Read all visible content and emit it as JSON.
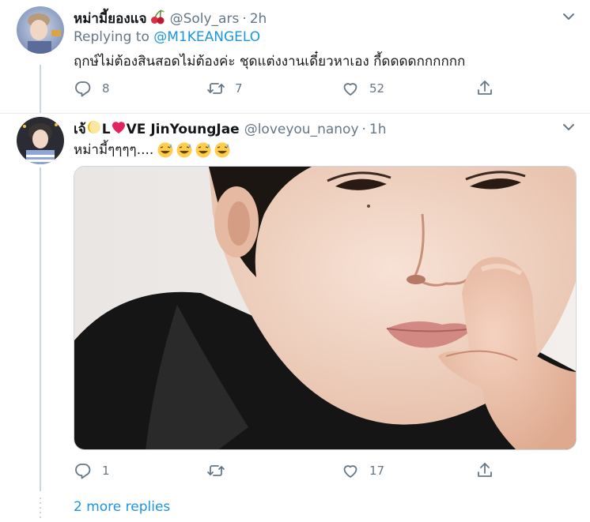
{
  "tweet1": {
    "display_name": "หม่ามี้ยองแจ",
    "handle": "@Soly_ars",
    "separator": "·",
    "time": "2h",
    "replying_label": "Replying to",
    "replying_to": "@M1KEANGELO",
    "text": "ฤกษ์ไม่ต้องสินสอดไม่ต้องค่ะ ชุดแต่งงานเดี๋ยวหาเอง กี้ดดดดกกกกกก",
    "replies": "8",
    "retweets": "7",
    "likes": "52"
  },
  "tweet2": {
    "display_name_prefix": "เจ้",
    "display_name_mid": "L",
    "display_name_suffix": "VE JinYoungJae",
    "handle": "@loveyou_nanoy",
    "separator": "·",
    "time": "1h",
    "text": "หม่ามี้ๆๆๆๆ....",
    "replies": "1",
    "retweets": "",
    "likes": "17"
  },
  "more_replies": "2 more replies",
  "colors": {
    "link": "#1b95e0",
    "muted": "#657786",
    "text": "#14171a",
    "thread_line": "#ccd6dd"
  }
}
